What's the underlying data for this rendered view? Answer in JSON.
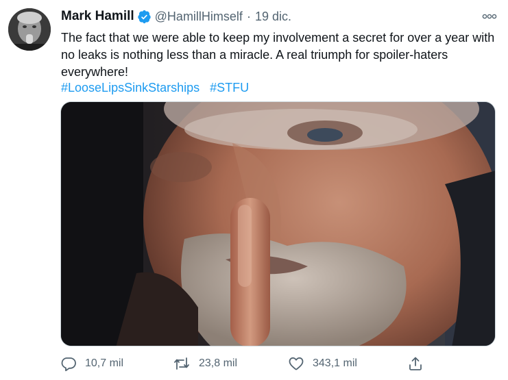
{
  "tweet": {
    "author": {
      "name": "Mark Hamill",
      "handle": "@HamillHimself",
      "verified": true
    },
    "separator": "·",
    "date": "19 dic.",
    "text": "The fact that we were able to keep my involvement a secret for over a year with no leaks is nothing less than a miracle. A real triumph for spoiler-haters everywhere!",
    "hashtags": [
      "#LooseLipsSinkStarships",
      "#STFU"
    ],
    "stats": {
      "replies": "10,7 mil",
      "retweets": "23,8 mil",
      "likes": "343,1 mil"
    }
  },
  "colors": {
    "accent": "#1d9bf0",
    "secondary_text": "#536471",
    "primary_text": "#0f1419",
    "verified_badge": "#1d9bf0"
  },
  "icons": {
    "more": "more-horizontal-icon",
    "verified": "verified-badge-icon",
    "reply": "reply-icon",
    "retweet": "retweet-icon",
    "like": "heart-icon",
    "share": "share-icon"
  }
}
